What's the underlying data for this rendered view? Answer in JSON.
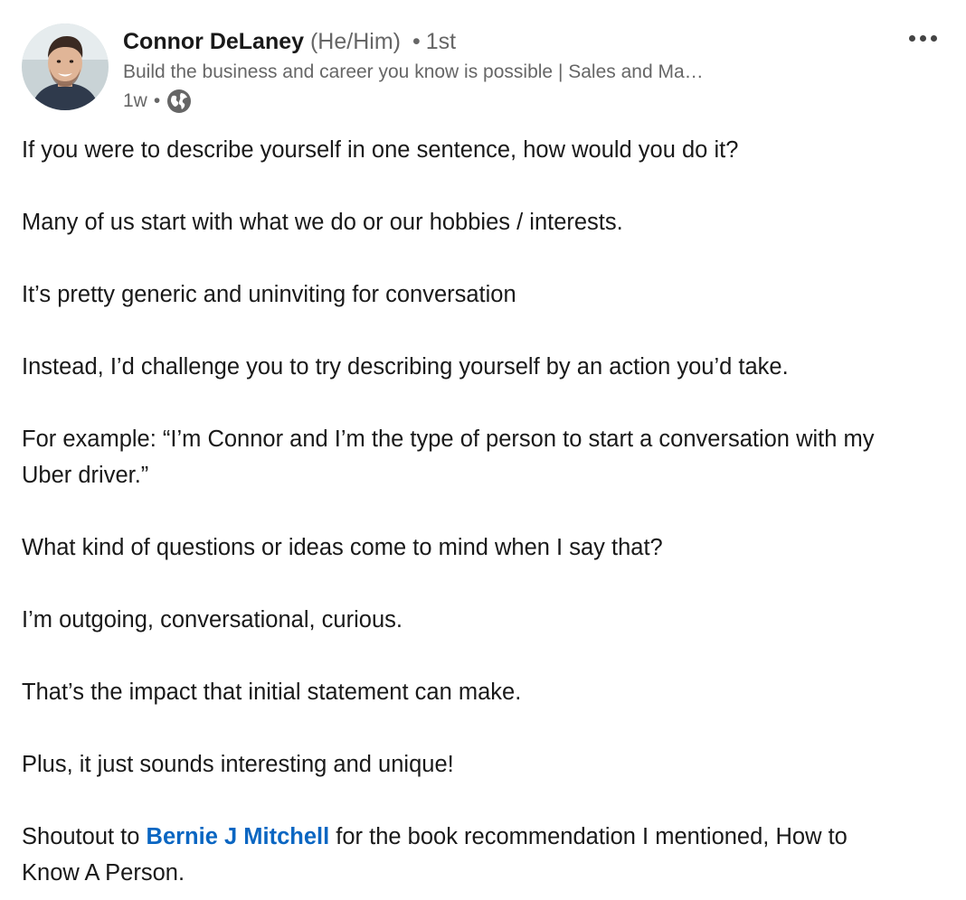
{
  "author": {
    "name": "Connor DeLaney",
    "pronouns": "(He/Him)",
    "separator": "•",
    "degree": "1st",
    "headline": "Build the business and career you know is possible | Sales and Ma…",
    "time_ago": "1w",
    "visibility_icon": "globe-icon"
  },
  "menu": {
    "icon": "ellipsis-icon"
  },
  "post": {
    "p1": "If you were to describe yourself in one sentence, how would you do it?",
    "p2": "Many of us start with what we do or our hobbies / interests.",
    "p3": "It’s pretty generic and uninviting for conversation",
    "p4": "Instead, I’d challenge you to try describing yourself by an action you’d take.",
    "p5": "For example: “I’m Connor and I’m the type of person to start a conversation with my Uber driver.”",
    "p6": "What kind of questions or ideas come to mind when I say that?",
    "p7": "I’m outgoing, conversational, curious.",
    "p8": "That’s the impact that initial statement can make.",
    "p9": "Plus, it just sounds interesting and unique!",
    "p10_before": "Shoutout to ",
    "p10_mention": "Bernie J Mitchell",
    "p10_after": " for the book recommendation I mentioned, How to Know A Person."
  },
  "colors": {
    "mention": "#0a66c2",
    "text": "#191919",
    "secondary": "#666666"
  }
}
